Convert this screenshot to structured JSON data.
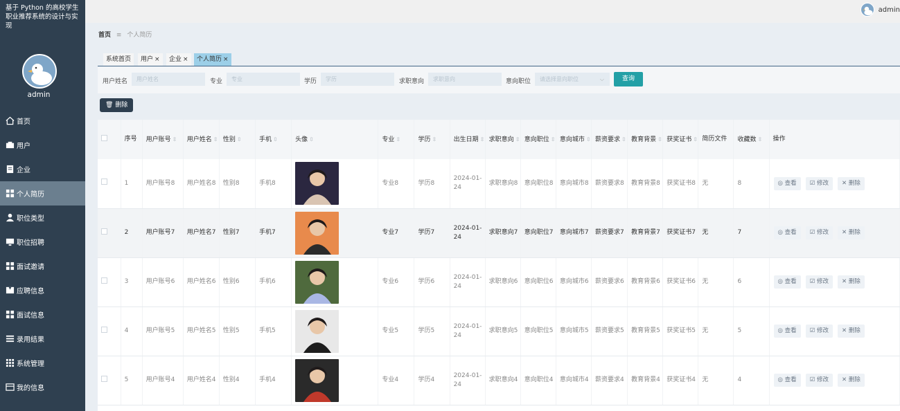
{
  "app": {
    "title": "基于 Python 的高校学生职业推荐系统的设计与实现",
    "user": "admin"
  },
  "sidebar": {
    "items": [
      {
        "label": "首页",
        "icon": "home-icon",
        "active": false
      },
      {
        "label": "用户",
        "icon": "user-icon",
        "active": false
      },
      {
        "label": "企业",
        "icon": "document-icon",
        "active": false
      },
      {
        "label": "个人简历",
        "icon": "grid-icon",
        "active": true
      },
      {
        "label": "职位类型",
        "icon": "person-icon",
        "active": false
      },
      {
        "label": "职位招聘",
        "icon": "monitor-icon",
        "active": false
      },
      {
        "label": "面试邀请",
        "icon": "grid-icon",
        "active": false
      },
      {
        "label": "应聘信息",
        "icon": "bookmark-icon",
        "active": false
      },
      {
        "label": "面试信息",
        "icon": "grid-icon",
        "active": false
      },
      {
        "label": "录用结果",
        "icon": "list-icon",
        "active": false
      },
      {
        "label": "系统管理",
        "icon": "apps-icon",
        "active": false
      },
      {
        "label": "我的信息",
        "icon": "window-icon",
        "active": false
      }
    ]
  },
  "breadcrumb": {
    "home": "首页",
    "sep": "≡",
    "current": "个人简历"
  },
  "tabs": [
    {
      "label": "系统首页",
      "closable": false
    },
    {
      "label": "用户",
      "closable": true
    },
    {
      "label": "企业",
      "closable": true
    },
    {
      "label": "个人简历",
      "closable": true
    }
  ],
  "search": {
    "fields": [
      {
        "label": "用户姓名",
        "placeholder": "用户姓名"
      },
      {
        "label": "专业",
        "placeholder": "专业"
      },
      {
        "label": "学历",
        "placeholder": "学历"
      },
      {
        "label": "求职意向",
        "placeholder": "求职意向"
      }
    ],
    "select": {
      "label": "意向职位",
      "placeholder": "请选择意向职位"
    },
    "query_label": "查询"
  },
  "delete_label": "删除",
  "table": {
    "columns": [
      "序号",
      "用户账号",
      "用户姓名",
      "性别",
      "手机",
      "头像",
      "专业",
      "学历",
      "出生日期",
      "求职意向",
      "意向职位",
      "意向城市",
      "薪资要求",
      "教育背景",
      "获奖证书",
      "简历文件",
      "收藏数",
      "操作"
    ],
    "actions": {
      "view": "查看",
      "edit": "修改",
      "delete": "删除"
    },
    "rows": [
      {
        "no": "1",
        "account": "用户账号8",
        "name": "用户姓名8",
        "gender": "性别8",
        "phone": "手机8",
        "major": "专业8",
        "edu": "学历8",
        "birth": "2024-01-24",
        "intent": "求职意向8",
        "position": "意向职位8",
        "city": "意向城市8",
        "salary": "薪资要求8",
        "background": "教育背景8",
        "cert": "获奖证书8",
        "file": "无",
        "fav": "8",
        "photo_colors": [
          "#2b2740",
          "#d9c4b2"
        ]
      },
      {
        "no": "2",
        "account": "用户账号7",
        "name": "用户姓名7",
        "gender": "性别7",
        "phone": "手机7",
        "major": "专业7",
        "edu": "学历7",
        "birth": "2024-01-24",
        "intent": "求职意向7",
        "position": "意向职位7",
        "city": "意向城市7",
        "salary": "薪资要求7",
        "background": "教育背景7",
        "cert": "获奖证书7",
        "file": "无",
        "fav": "7",
        "photo_colors": [
          "#e88a4c",
          "#2b2b2b"
        ]
      },
      {
        "no": "3",
        "account": "用户账号6",
        "name": "用户姓名6",
        "gender": "性别6",
        "phone": "手机6",
        "major": "专业6",
        "edu": "学历6",
        "birth": "2024-01-24",
        "intent": "求职意向6",
        "position": "意向职位6",
        "city": "意向城市6",
        "salary": "薪资要求6",
        "background": "教育背景6",
        "cert": "获奖证书6",
        "file": "无",
        "fav": "6",
        "photo_colors": [
          "#4f6a3d",
          "#a9b7e4"
        ]
      },
      {
        "no": "4",
        "account": "用户账号5",
        "name": "用户姓名5",
        "gender": "性别5",
        "phone": "手机5",
        "major": "专业5",
        "edu": "学历5",
        "birth": "2024-01-24",
        "intent": "求职意向5",
        "position": "意向职位5",
        "city": "意向城市5",
        "salary": "薪资要求5",
        "background": "教育背景5",
        "cert": "获奖证书5",
        "file": "无",
        "fav": "5",
        "photo_colors": [
          "#e8e8e8",
          "#1d1d1d"
        ]
      },
      {
        "no": "5",
        "account": "用户账号4",
        "name": "用户姓名4",
        "gender": "性别4",
        "phone": "手机4",
        "major": "专业4",
        "edu": "学历4",
        "birth": "2024-01-24",
        "intent": "求职意向4",
        "position": "意向职位4",
        "city": "意向城市4",
        "salary": "薪资要求4",
        "background": "教育背景4",
        "cert": "获奖证书4",
        "file": "无",
        "fav": "4",
        "photo_colors": [
          "#2a2a2a",
          "#c0392b"
        ]
      }
    ]
  }
}
